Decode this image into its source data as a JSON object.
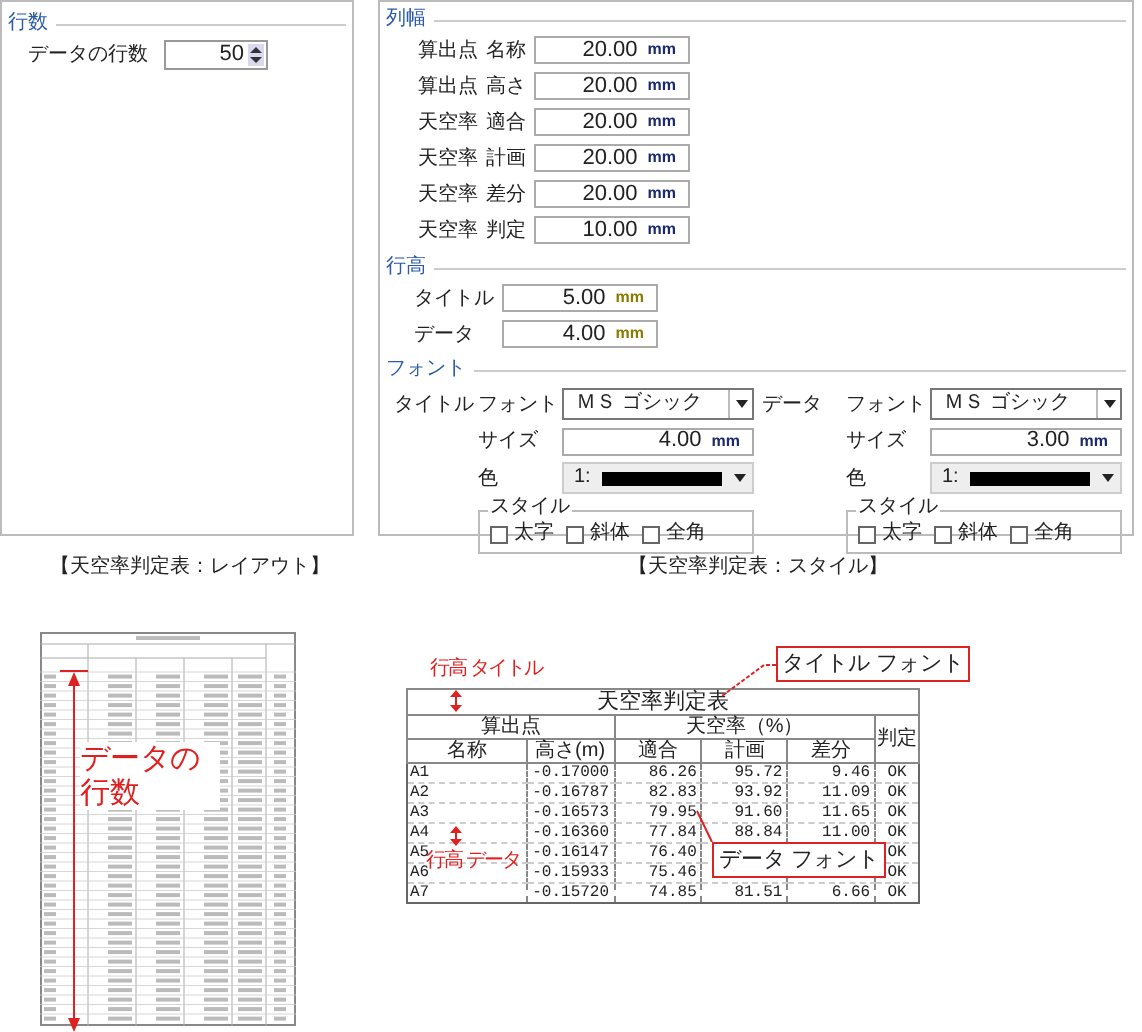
{
  "layout_panel": {
    "title": "行数",
    "rows_label": "データの行数",
    "rows_value": "50"
  },
  "style_panel": {
    "column_width": {
      "title": "列幅",
      "rows": [
        {
          "group": "算出点",
          "label": "名称",
          "value": "20.00",
          "unit": "mm"
        },
        {
          "group": "算出点",
          "label": "高さ",
          "value": "20.00",
          "unit": "mm"
        },
        {
          "group": "天空率",
          "label": "適合",
          "value": "20.00",
          "unit": "mm"
        },
        {
          "group": "天空率",
          "label": "計画",
          "value": "20.00",
          "unit": "mm"
        },
        {
          "group": "天空率",
          "label": "差分",
          "value": "20.00",
          "unit": "mm"
        },
        {
          "group": "天空率",
          "label": "判定",
          "value": "10.00",
          "unit": "mm"
        }
      ]
    },
    "row_height": {
      "title": "行高",
      "rows": [
        {
          "label": "タイトル",
          "value": "5.00",
          "unit": "mm"
        },
        {
          "label": "データ",
          "value": "4.00",
          "unit": "mm"
        }
      ]
    },
    "font": {
      "title": "フォント",
      "targets": [
        {
          "label": "タイトル",
          "font_label": "フォント",
          "font": "ＭＳ ゴシック",
          "size_label": "サイズ",
          "size": "4.00",
          "unit": "mm",
          "color_label": "色",
          "color_value": "1:",
          "style_title": "スタイル",
          "styles": [
            {
              "label": "太字",
              "checked": false
            },
            {
              "label": "斜体",
              "checked": false
            },
            {
              "label": "全角",
              "checked": false
            }
          ]
        },
        {
          "label": "データ",
          "font_label": "フォント",
          "font": "ＭＳ ゴシック",
          "size_label": "サイズ",
          "size": "3.00",
          "unit": "mm",
          "color_label": "色",
          "color_value": "1:",
          "style_title": "スタイル",
          "styles": [
            {
              "label": "太字",
              "checked": false
            },
            {
              "label": "斜体",
              "checked": false
            },
            {
              "label": "全角",
              "checked": false
            }
          ]
        }
      ]
    }
  },
  "captions": [
    "【天空率判定表：レイアウト】",
    "【天空率判定表：スタイル】"
  ],
  "layout_example": {
    "annotation": "データの行数"
  },
  "style_example": {
    "table": {
      "title": "天空率判定表",
      "group_headers": [
        "算出点",
        "天空率（%）",
        "判定"
      ],
      "columns": [
        "名称",
        "高さ(m)",
        "適合",
        "計画",
        "差分"
      ],
      "rows": [
        [
          "A1",
          "-0.17000",
          "86.26",
          "95.72",
          "9.46",
          "OK"
        ],
        [
          "A2",
          "-0.16787",
          "82.83",
          "93.92",
          "11.09",
          "OK"
        ],
        [
          "A3",
          "-0.16573",
          "79.95",
          "91.60",
          "11.65",
          "OK"
        ],
        [
          "A4",
          "-0.16360",
          "77.84",
          "88.84",
          "11.00",
          "OK"
        ],
        [
          "A5",
          "-0.16147",
          "76.40",
          null,
          null,
          "OK"
        ],
        [
          "A6",
          "-0.15933",
          "75.46",
          null,
          null,
          "OK"
        ],
        [
          "A7",
          "-0.15720",
          "74.85",
          "81.51",
          "6.66",
          "OK"
        ]
      ]
    },
    "annotations": [
      {
        "kind": "dimension",
        "text": "行高 タイトル"
      },
      {
        "kind": "callout",
        "text": "タイトル フォント"
      },
      {
        "kind": "dimension",
        "text": "行高 データ"
      },
      {
        "kind": "callout",
        "text": "データ フォント"
      }
    ]
  }
}
